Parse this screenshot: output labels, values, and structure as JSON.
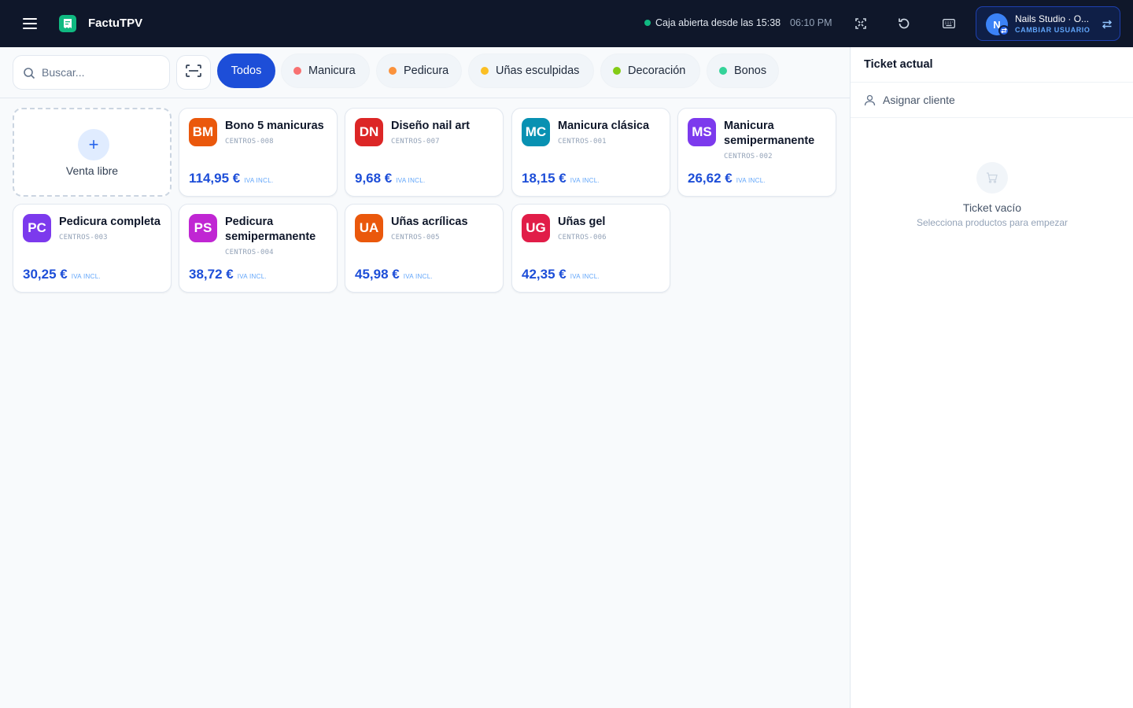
{
  "header": {
    "app_name": "FactuTPV",
    "status_text": "Caja abierta desde las 15:38",
    "time": "06:10 PM",
    "user": {
      "initial": "N",
      "name": "Nails Studio · O...",
      "action": "CAMBIAR USUARIO"
    }
  },
  "search": {
    "placeholder": "Buscar..."
  },
  "categories": [
    {
      "label": "Todos",
      "color": "",
      "active": true
    },
    {
      "label": "Manicura",
      "color": "#f87171"
    },
    {
      "label": "Pedicura",
      "color": "#fb923c"
    },
    {
      "label": "Uñas esculpidas",
      "color": "#fbbf24"
    },
    {
      "label": "Decoración",
      "color": "#84cc16"
    },
    {
      "label": "Bonos",
      "color": "#34d399"
    }
  ],
  "free_sale": {
    "icon": "+",
    "label": "Venta libre"
  },
  "products": [
    {
      "initials": "BM",
      "name": "Bono 5 manicuras",
      "sku": "CENTROS-008",
      "price": "114,95 €",
      "tax_note": "IVA INCL.",
      "color": "#ea580c"
    },
    {
      "initials": "DN",
      "name": "Diseño nail art",
      "sku": "CENTROS-007",
      "price": "9,68 €",
      "tax_note": "IVA INCL.",
      "color": "#dc2626"
    },
    {
      "initials": "MC",
      "name": "Manicura clásica",
      "sku": "CENTROS-001",
      "price": "18,15 €",
      "tax_note": "IVA INCL.",
      "color": "#0891b2"
    },
    {
      "initials": "MS",
      "name": "Manicura semipermanente",
      "sku": "CENTROS-002",
      "price": "26,62 €",
      "tax_note": "IVA INCL.",
      "color": "#7c3aed"
    },
    {
      "initials": "PC",
      "name": "Pedicura completa",
      "sku": "CENTROS-003",
      "price": "30,25 €",
      "tax_note": "IVA INCL.",
      "color": "#7c3aed"
    },
    {
      "initials": "PS",
      "name": "Pedicura semipermanente",
      "sku": "CENTROS-004",
      "price": "38,72 €",
      "tax_note": "IVA INCL.",
      "color": "#c026d3"
    },
    {
      "initials": "UA",
      "name": "Uñas acrílicas",
      "sku": "CENTROS-005",
      "price": "45,98 €",
      "tax_note": "IVA INCL.",
      "color": "#ea580c"
    },
    {
      "initials": "UG",
      "name": "Uñas gel",
      "sku": "CENTROS-006",
      "price": "42,35 €",
      "tax_note": "IVA INCL.",
      "color": "#e11d48"
    }
  ],
  "ticket": {
    "title": "Ticket actual",
    "assign_label": "Asignar cliente",
    "empty_title": "Ticket vacío",
    "empty_subtitle": "Selecciona productos para empezar"
  },
  "icons": {
    "menu": "menu-icon",
    "logo": "receipt-logo-icon",
    "fullscreen": "fullscreen-icon",
    "refresh": "refresh-icon",
    "keyboard": "keyboard-icon",
    "swap": "swap-icon",
    "search": "search-icon",
    "scan": "barcode-scan-icon",
    "user": "user-icon",
    "cart": "cart-icon"
  },
  "colors": {
    "topbar": "#0f172a",
    "accent": "#1d4ed8",
    "status_ok": "#10b981"
  }
}
